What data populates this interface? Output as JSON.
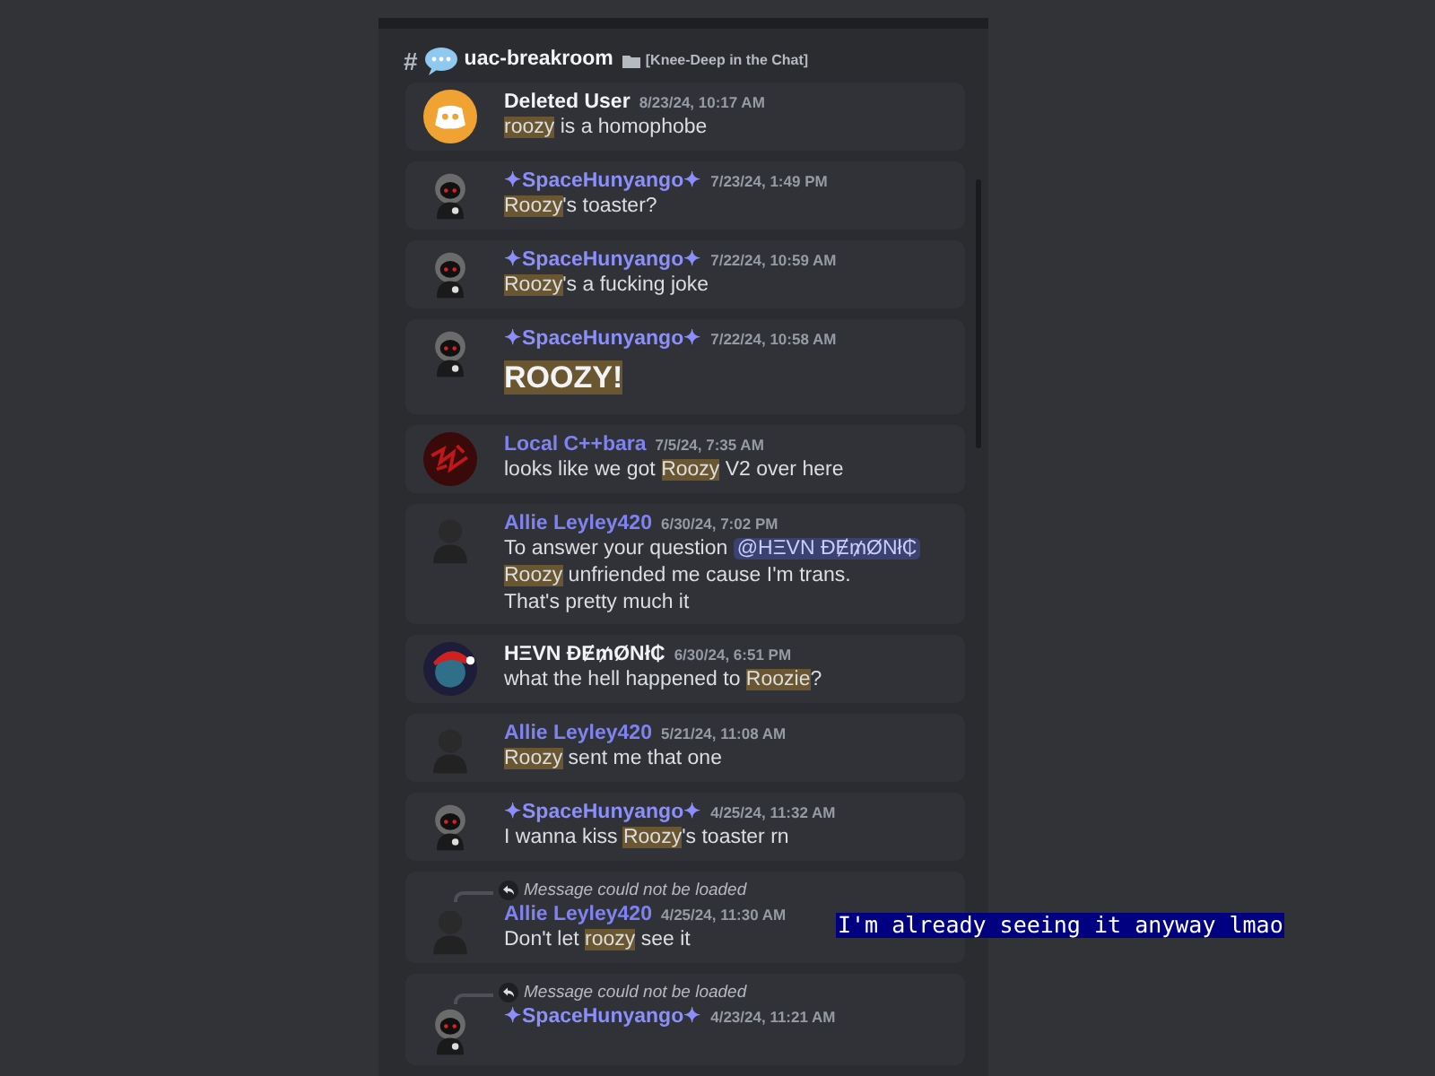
{
  "channel": {
    "prefix": "#",
    "name": "uac-breakroom",
    "category": "[Knee-Deep in the Chat]"
  },
  "messages": [
    {
      "author": "Deleted User",
      "color": "#f2f3f5",
      "time": "8/23/24, 10:17 AM",
      "kind": "discord",
      "big": false,
      "lines": [
        [
          {
            "kind": "highlight",
            "text": "roozy"
          },
          {
            "kind": "plain",
            "text": " is a homophobe"
          }
        ]
      ]
    },
    {
      "author": "✦SpaceHunyango✦",
      "color": "#8c8ffa",
      "time": "7/23/24, 1:49 PM",
      "kind": "hood",
      "big": false,
      "lines": [
        [
          {
            "kind": "highlight",
            "text": "Roozy"
          },
          {
            "kind": "plain",
            "text": "'s toaster?"
          }
        ]
      ]
    },
    {
      "author": "✦SpaceHunyango✦",
      "color": "#8c8ffa",
      "time": "7/22/24, 10:59 AM",
      "kind": "hood",
      "big": false,
      "lines": [
        [
          {
            "kind": "highlight",
            "text": "Roozy"
          },
          {
            "kind": "plain",
            "text": "'s a fucking joke"
          }
        ]
      ]
    },
    {
      "author": "✦SpaceHunyango✦",
      "color": "#8c8ffa",
      "time": "7/22/24, 10:58 AM",
      "kind": "hood",
      "big": true,
      "lines": [
        [
          {
            "kind": "highlight",
            "text": "ROOZY!"
          }
        ]
      ]
    },
    {
      "author": "Local C++bara",
      "color": "#7f83f2",
      "time": "7/5/24, 7:35 AM",
      "kind": "red",
      "big": false,
      "lines": [
        [
          {
            "kind": "plain",
            "text": "looks like we got "
          },
          {
            "kind": "highlight",
            "text": "Roozy"
          },
          {
            "kind": "plain",
            "text": " V2 over here"
          }
        ]
      ]
    },
    {
      "author": "Allie Leyley420",
      "color": "#7f83f2",
      "time": "6/30/24, 7:02 PM",
      "kind": "person",
      "big": false,
      "lines": [
        [
          {
            "kind": "plain",
            "text": "To answer your question "
          },
          {
            "kind": "mention",
            "text": "@HΞVN ĐɆ₥ØNł₵"
          }
        ],
        [
          {
            "kind": "highlight",
            "text": "Roozy"
          },
          {
            "kind": "plain",
            "text": " unfriended me cause I'm trans."
          }
        ],
        [
          {
            "kind": "plain",
            "text": "That's pretty much it"
          }
        ]
      ]
    },
    {
      "author": "HΞVN ĐɆ₥ØNł₵",
      "color": "#f2f3f5",
      "time": "6/30/24, 6:51 PM",
      "kind": "santa",
      "big": false,
      "lines": [
        [
          {
            "kind": "plain",
            "text": "what the hell happened to "
          },
          {
            "kind": "highlight",
            "text": "Roozie"
          },
          {
            "kind": "plain",
            "text": "?"
          }
        ]
      ]
    },
    {
      "author": "Allie Leyley420",
      "color": "#7f83f2",
      "time": "5/21/24, 11:08 AM",
      "kind": "person",
      "big": false,
      "lines": [
        [
          {
            "kind": "highlight",
            "text": "Roozy"
          },
          {
            "kind": "plain",
            "text": " sent me that one"
          }
        ]
      ]
    },
    {
      "author": "✦SpaceHunyango✦",
      "color": "#8c8ffa",
      "time": "4/25/24, 11:32 AM",
      "kind": "hood",
      "big": false,
      "lines": [
        [
          {
            "kind": "plain",
            "text": "I wanna kiss "
          },
          {
            "kind": "highlight",
            "text": "Roozy"
          },
          {
            "kind": "plain",
            "text": "'s toaster rn"
          }
        ]
      ]
    },
    {
      "author": "Allie Leyley420",
      "color": "#7f83f2",
      "time": "4/25/24, 11:30 AM",
      "kind": "person",
      "big": false,
      "reply": "Message could not be loaded",
      "lines": [
        [
          {
            "kind": "plain",
            "text": "Don't let "
          },
          {
            "kind": "highlight",
            "text": "roozy"
          },
          {
            "kind": "plain",
            "text": " see it"
          }
        ]
      ]
    },
    {
      "author": "✦SpaceHunyango✦",
      "color": "#8c8ffa",
      "time": "4/23/24, 11:21 AM",
      "kind": "hood",
      "reply": "Message could not be loaded"
    }
  ],
  "overlay_text": "I'm already seeing it anyway lmao"
}
